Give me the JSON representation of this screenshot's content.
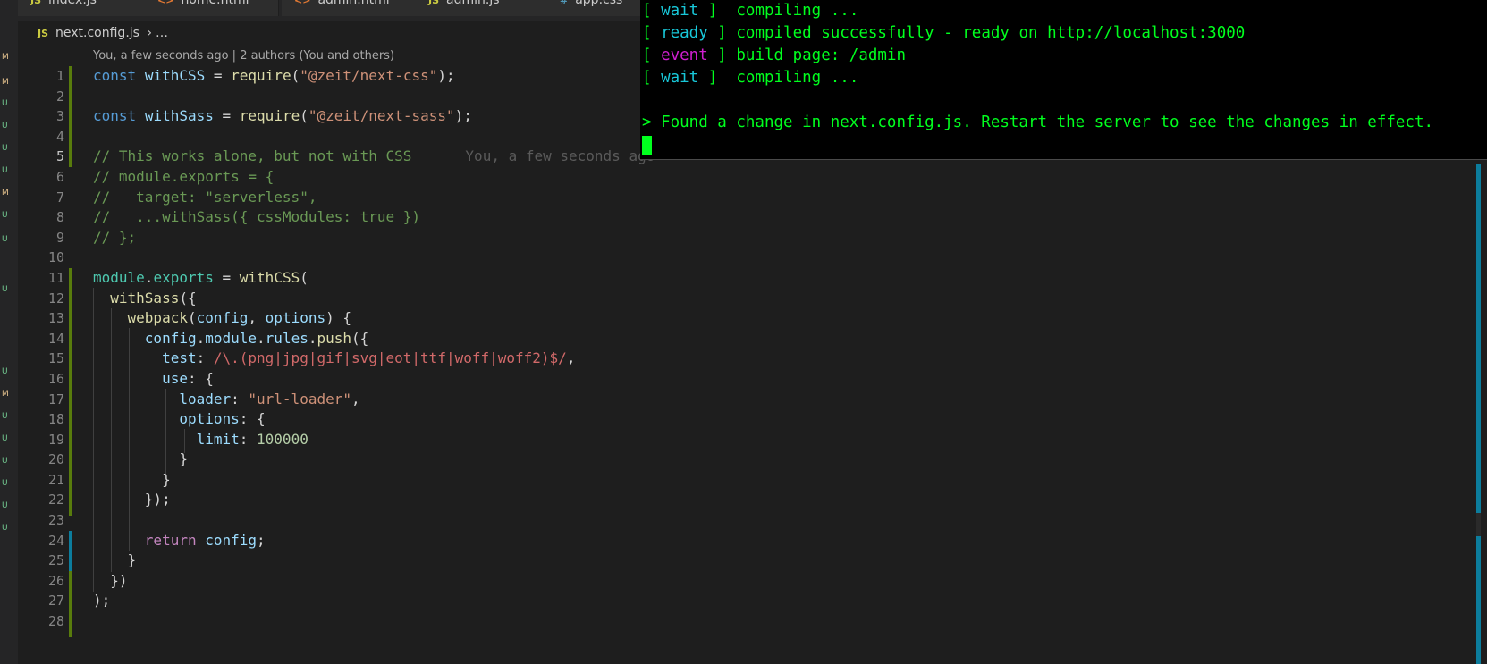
{
  "tabs": [
    {
      "icon": "JS",
      "icon_kind": "js",
      "label": "index.js"
    },
    {
      "icon": "<>",
      "icon_kind": "html",
      "label": "home.html"
    },
    {
      "icon": "<>",
      "icon_kind": "html",
      "label": "admin.html"
    },
    {
      "icon": "JS",
      "icon_kind": "js",
      "label": "admin.js"
    },
    {
      "icon": "#",
      "icon_kind": "css",
      "label": "app.css"
    }
  ],
  "breadcrumb": {
    "icon": "JS",
    "file": "next.config.js",
    "chevron": "›",
    "more": "…"
  },
  "codelens": "You, a few seconds ago | 2 authors (You and others)",
  "blame": "You, a few seconds ago",
  "git_marks": [
    "M",
    "M",
    "U",
    "U",
    "U",
    "U",
    "M",
    "U",
    "U",
    "U",
    "U",
    "M",
    "U",
    "U",
    "U",
    "U",
    "U",
    "U"
  ],
  "colors": {
    "modified": "#e2c08d",
    "untracked": "#73c991",
    "git_added_bar": "#587c0c",
    "git_modified_bar": "#0c7d9d",
    "terminal_green": "#00ff1e"
  },
  "terminal": {
    "lines": [
      {
        "bracket_open": "[ ",
        "tag": "wait",
        "tag_color": "cyan",
        "bracket_close": " ]",
        "msg": "  compiling ..."
      },
      {
        "bracket_open": "[ ",
        "tag": "ready",
        "tag_color": "cyan",
        "bracket_close": " ]",
        "msg": " compiled successfully - ready on http://localhost:3000"
      },
      {
        "bracket_open": "[ ",
        "tag": "event",
        "tag_color": "magenta",
        "bracket_close": " ]",
        "msg": " build page: /admin"
      },
      {
        "bracket_open": "[ ",
        "tag": "wait",
        "tag_color": "cyan",
        "bracket_close": " ]",
        "msg": "  compiling ..."
      }
    ],
    "notice": "> Found a change in next.config.js. Restart the server to see the changes in effect."
  },
  "active_line": 5,
  "line_count": 28
}
